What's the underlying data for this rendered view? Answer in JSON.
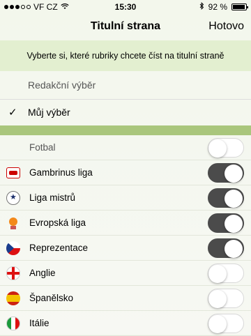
{
  "status_bar": {
    "carrier": "VF CZ",
    "time": "15:30",
    "battery_text": "92 %",
    "battery_level": 0.92,
    "signal_dots": 3
  },
  "nav": {
    "title": "Titulní strana",
    "done_label": "Hotovo"
  },
  "banner": {
    "text": "Vyberte si, které rubriky chcete číst na titulní straně"
  },
  "modes": [
    {
      "label": "Redakční výběr",
      "selected": false
    },
    {
      "label": "Můj výběr",
      "selected": true
    }
  ],
  "sections": [
    {
      "label": "Fotbal",
      "icon": "none",
      "on": false
    },
    {
      "label": "Gambrinus liga",
      "icon": "gambrinus-logo-icon",
      "on": true
    },
    {
      "label": "Liga mistrů",
      "icon": "champions-league-icon",
      "on": true
    },
    {
      "label": "Evropská liga",
      "icon": "europa-league-icon",
      "on": true
    },
    {
      "label": "Reprezentace",
      "icon": "czech-flag-icon",
      "on": true
    },
    {
      "label": "Anglie",
      "icon": "england-flag-icon",
      "on": false
    },
    {
      "label": "Španělsko",
      "icon": "spain-flag-icon",
      "on": false
    },
    {
      "label": "Itálie",
      "icon": "italy-flag-icon",
      "on": false
    }
  ],
  "colors": {
    "banner_bg": "#e3efd0",
    "divider": "#a9c67c",
    "toggle_on": "#4b4b4b"
  }
}
